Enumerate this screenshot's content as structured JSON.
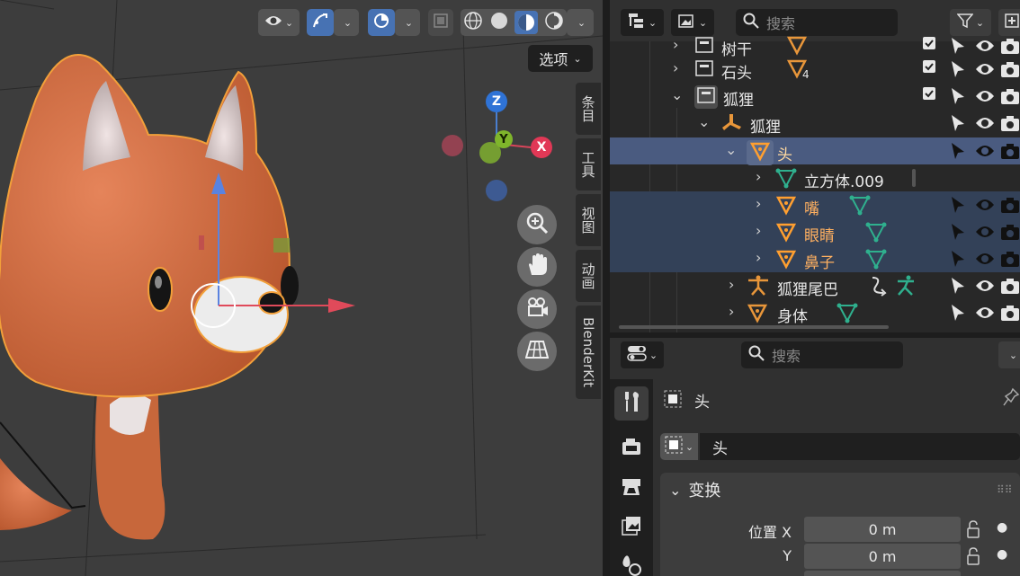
{
  "viewport": {
    "options_label": "选项",
    "side_tabs": [
      "条目",
      "工具",
      "视图",
      "动画",
      "BlenderKit"
    ],
    "gizmo": {
      "z": "Z",
      "y": "Y",
      "x": "X"
    }
  },
  "outliner": {
    "search_placeholder": "搜索",
    "rows": [
      {
        "label": "树干",
        "type": "collection"
      },
      {
        "label": "石头",
        "type": "collection",
        "badge": "4"
      },
      {
        "label": "狐狸",
        "type": "collection"
      },
      {
        "label": "狐狸",
        "type": "armature"
      },
      {
        "label": "头",
        "type": "mesh"
      },
      {
        "label": "立方体.009",
        "type": "mesh-data"
      },
      {
        "label": "嘴",
        "type": "mesh"
      },
      {
        "label": "眼睛",
        "type": "mesh"
      },
      {
        "label": "鼻子",
        "type": "mesh"
      },
      {
        "label": "狐狸尾巴",
        "type": "armature"
      },
      {
        "label": "身体",
        "type": "mesh"
      }
    ]
  },
  "properties": {
    "search_placeholder": "搜索",
    "object_name": "头",
    "name_field": "头",
    "transform_header": "变换",
    "location_label_x": "位置 X",
    "location_label_y": "Y",
    "location_x": "0 m",
    "location_y": "0 m"
  }
}
